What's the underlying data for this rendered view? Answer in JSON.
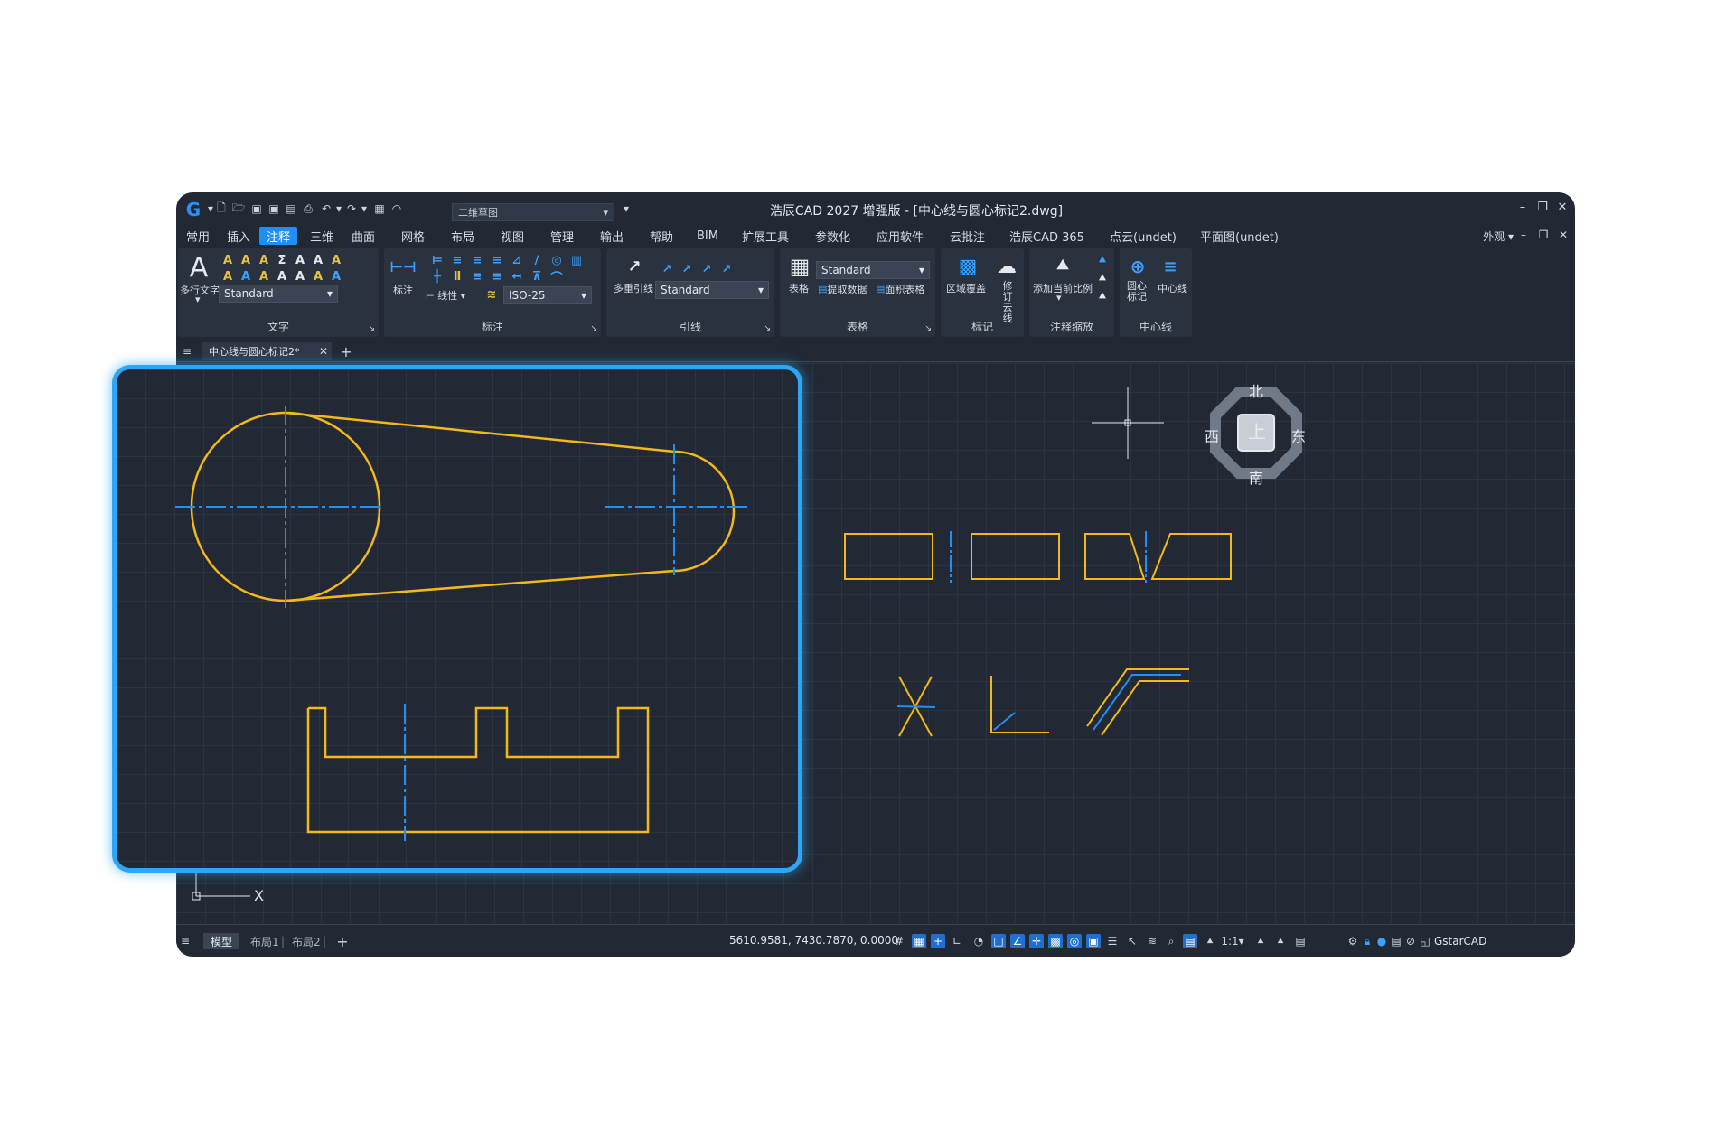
{
  "title_bar": {
    "app_title": "浩辰CAD 2027 增强版 - [中心线与圆心标记2.dwg]",
    "workspace": "二维草图"
  },
  "menu": {
    "tabs": [
      "常用",
      "插入",
      "注释",
      "三维",
      "曲面",
      "网格",
      "布局",
      "视图",
      "管理",
      "输出",
      "帮助",
      "BIM",
      "扩展工具",
      "参数化",
      "应用软件",
      "云批注",
      "浩辰CAD 365",
      "点云(undet)",
      "平面图(undet)"
    ],
    "active_tab": "注释",
    "appearance_label": "外观"
  },
  "ribbon": {
    "text_panel": {
      "title": "文字",
      "mtext_label": "多行文字",
      "style_value": "Standard"
    },
    "dim_panel": {
      "title": "标注",
      "dim_label": "标注",
      "linear_label": "线性",
      "dim_style_value": "ISO-25"
    },
    "leader_panel": {
      "title": "引线",
      "mleader_label": "多重引线",
      "leader_style_value": "Standard"
    },
    "table_panel": {
      "title": "表格",
      "table_label": "表格",
      "table_style_value": "Standard",
      "extract_label": "提取数据",
      "area_table_label": "面积表格"
    },
    "mark_panel": {
      "title": "标记",
      "wipeout_label": "区域覆盖",
      "revcloud_label": "修订云线"
    },
    "scale_panel": {
      "title": "注释缩放",
      "add_scale_label": "添加当前比例"
    },
    "centerline_panel": {
      "title": "中心线",
      "center_mark_label": "圆心标记",
      "centerline_label": "中心线"
    }
  },
  "document": {
    "tab_title": "中心线与圆心标记2*"
  },
  "viewcube": {
    "north": "北",
    "south": "南",
    "east": "东",
    "west": "西",
    "top": "上"
  },
  "ucs": {
    "x_label": "X"
  },
  "status_bar": {
    "model_tab": "模型",
    "layout1_tab": "布局1",
    "layout2_tab": "布局2",
    "coordinates": "5610.9581, 7430.7870, 0.0000",
    "scale": "1:1",
    "brand": "GstarCAD"
  },
  "colors": {
    "accent": "#1f8ff5",
    "drawing_lines": "#f2b81c",
    "center_lines": "#1f8ff5",
    "callout_border": "#2ea6f5"
  }
}
